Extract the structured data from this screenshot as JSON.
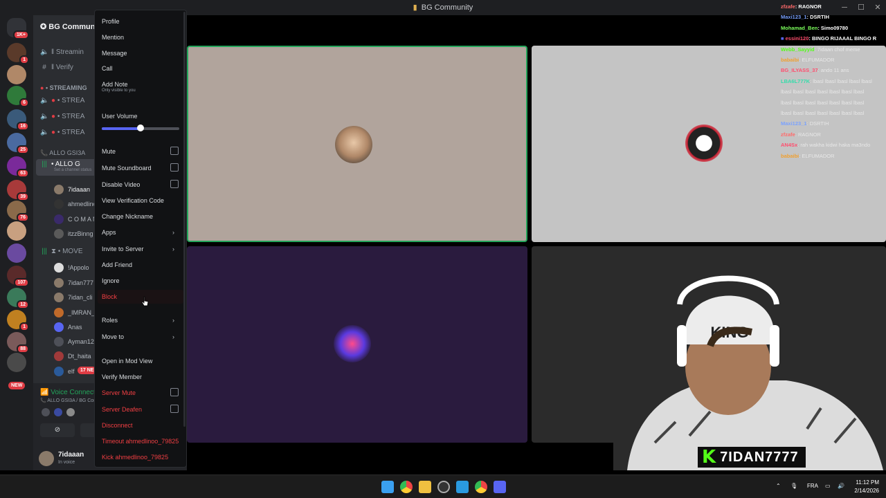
{
  "window": {
    "title": "BG Community"
  },
  "rail": {
    "badges": [
      "1K+",
      "1",
      "6",
      "16",
      "25",
      "63",
      "39",
      "76",
      "107",
      "12",
      "1",
      "88"
    ],
    "new_label": "NEW"
  },
  "sidebar": {
    "guild_name": "BG Community",
    "channels": [
      {
        "icon": "speaker-icon",
        "label": "‖ Streamin"
      },
      {
        "icon": "hash-icon",
        "label": "‖ Verify"
      }
    ],
    "streaming_category": "• STREAMING",
    "stream_channels": [
      "• STREA",
      "• STREA",
      "• STREA"
    ],
    "allo_category": "ALLO GSI3A",
    "active_channel": {
      "label": "• ALLO G",
      "status": "Set a channel status"
    },
    "voice_users": [
      "7idaaan",
      "ahmedlinoo",
      "C O M A N",
      "itzzBinng"
    ],
    "move_category": "• MOVE",
    "move_users": [
      "!Appolo",
      "7idan777",
      "7idan_cli",
      "_IMRAN_",
      "Anas",
      "Ayman12",
      "Dt_haita",
      "elf"
    ],
    "live_pill": "17 NE"
  },
  "voice_panel": {
    "status": "Voice Connected",
    "location": "ALLO GSI3A / BG Com"
  },
  "user": {
    "name": "7idaaan",
    "status": "In voice"
  },
  "context_menu": {
    "items_top": [
      "Profile",
      "Mention",
      "Message",
      "Call"
    ],
    "add_note": "Add Note",
    "add_note_sub": "Only visible to you",
    "user_volume_label": "User Volume",
    "user_volume_value": 0.5,
    "checkbox_items": [
      "Mute",
      "Mute Soundboard",
      "Disable Video"
    ],
    "view_verification": "View Verification Code",
    "change_nickname": "Change Nickname",
    "apps": "Apps",
    "invite": "Invite to Server",
    "add_friend": "Add Friend",
    "ignore": "Ignore",
    "block": "Block",
    "roles": "Roles",
    "move_to": "Move to",
    "open_mod_view": "Open in Mod View",
    "verify_member": "Verify Member",
    "server_mute": "Server Mute",
    "server_deafen": "Server Deafen",
    "disconnect": "Disconnect",
    "timeout": "Timeout ahmedlinoo_79825",
    "kick": "Kick ahmedlinoo_79825"
  },
  "chat": [
    {
      "name": "zfzafe",
      "text": ": RAGNOR",
      "color": "#ff6b6b"
    },
    {
      "name": "Maxi123_1",
      "text": ": DSRTIH",
      "color": "#7aa2ff"
    },
    {
      "name": "Mohamad_Ben",
      "text": ": Simo09780",
      "color": "#7cff5c"
    },
    {
      "name": "essini120",
      "text": ": BINGO RIJAAAL BINGO R",
      "color": "#ff4d6d"
    },
    {
      "name": "Webb_Sayyid",
      "text": ": 7idaan chof meme",
      "color": "#53fc18",
      "dim": true
    },
    {
      "name": "babaibi",
      "text": ": ELFUMADOR",
      "color": "#f0a030",
      "dim": true
    },
    {
      "name": "BG_ILYASS_37",
      "text": ": ando 11 ans",
      "color": "#ff4d6d",
      "dim": true
    },
    {
      "name": "LBA6L777K",
      "text": ": lbasl lbasl lbasl lbasl lbasl",
      "color": "#33ddaa",
      "dim": true
    },
    {
      "name": "",
      "text": "lbasl lbasl lbasl lbasl lbasl lbasl lbasl",
      "color": "#ffffff",
      "dim": true
    },
    {
      "name": "",
      "text": "lbasl lbasl lbasl lbasl lbasl lbasl lbasl",
      "color": "#ffffff",
      "dim": true
    },
    {
      "name": "",
      "text": "lbasl lbasl lbasl lbasl lbasl lbasl lbasl",
      "color": "#ffffff",
      "dim": true
    },
    {
      "name": "Maxi123_1",
      "text": ": DSRTIH",
      "color": "#7aa2ff",
      "dim": true
    },
    {
      "name": "zfzafe",
      "text": ": RAGNOR",
      "color": "#ff6b6b",
      "dim": true
    },
    {
      "name": "AN4Sx",
      "text": ": rah wakha kidwi haka ma3ndo",
      "color": "#ff4d6d",
      "dim": true
    },
    {
      "name": "babaibi",
      "text": ": ELFUMADOR",
      "color": "#f0a030",
      "dim": true
    }
  ],
  "webcam": {
    "channel_name": "7IDAN7777",
    "cap_text": "KING"
  },
  "taskbar": {
    "language": "FRA",
    "time": "11:12 PM",
    "date": "2/14/2026"
  },
  "colors": {
    "accent": "#5865f2",
    "danger": "#f23f43",
    "online": "#23a55a",
    "kick_green": "#53fc18"
  }
}
